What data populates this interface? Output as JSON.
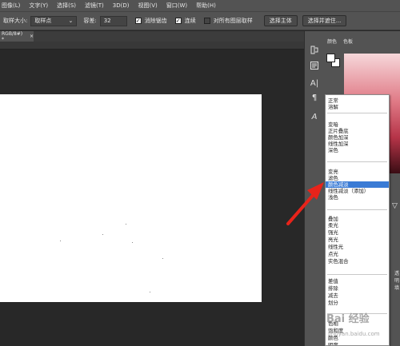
{
  "menu": {
    "items": [
      "图像(L)",
      "文字(Y)",
      "选择(S)",
      "滤镜(T)",
      "3D(D)",
      "视图(V)",
      "窗口(W)",
      "帮助(H)"
    ]
  },
  "options_bar": {
    "sample_size_label": "取样大小:",
    "sample_size_value": "取样点",
    "tolerance_label": "容差:",
    "tolerance_value": "32",
    "antialias_label": "消除锯齿",
    "contiguous_label": "连续",
    "all_layers_label": "对所有图层取样",
    "select_subject_label": "选择主体",
    "select_mask_label": "选择并遮住..."
  },
  "document": {
    "tab_label": "RGB/8#) *",
    "tab_close": "×"
  },
  "panel": {
    "tabs": [
      "颜色",
      "色板"
    ],
    "label_transparency": "透明",
    "label_fill": "填"
  },
  "blend_menu": {
    "groups": [
      [
        "正常",
        "溶解"
      ],
      [
        "变暗",
        "正片叠底",
        "颜色加深",
        "线性加深",
        "深色"
      ],
      [
        "变亮",
        "滤色",
        "颜色减淡",
        "线性减淡（添加）",
        "浅色"
      ],
      [
        "叠加",
        "柔光",
        "强光",
        "亮光",
        "线性光",
        "点光",
        "实色混合"
      ],
      [
        "差值",
        "排除",
        "减去",
        "划分"
      ],
      [
        "色相",
        "饱和度",
        "颜色",
        "明度"
      ]
    ],
    "selected": "颜色减淡"
  },
  "watermark": {
    "brand": "Bai 经验",
    "url": "jingyan.baidu.com"
  },
  "colors": {
    "ui_bg": "#535353",
    "canvas_bg": "#282828",
    "selection": "#3a7bd5",
    "arrow": "#e8231a"
  }
}
